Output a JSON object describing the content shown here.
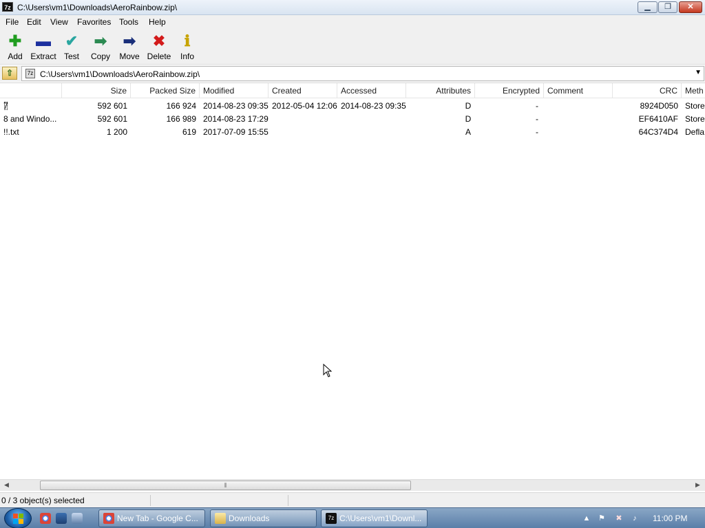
{
  "window": {
    "app_icon": "7z",
    "title": "C:\\Users\\vm1\\Downloads\\AeroRainbow.zip\\",
    "minimize": "▁",
    "maximize": "❐",
    "close": "✕"
  },
  "menu": [
    "File",
    "Edit",
    "View",
    "Favorites",
    "Tools",
    "Help"
  ],
  "toolbar": [
    {
      "label": "Add",
      "icon": "add-icon",
      "glyph": "✚",
      "color": "#1f9c1f"
    },
    {
      "label": "Extract",
      "icon": "extract-icon",
      "glyph": "▬",
      "color": "#1c2f9e"
    },
    {
      "label": "Test",
      "icon": "test-icon",
      "glyph": "✔",
      "color": "#2aa6a0"
    },
    {
      "label": "Copy",
      "icon": "copy-icon",
      "glyph": "➡",
      "color": "#2b8a52"
    },
    {
      "label": "Move",
      "icon": "move-icon",
      "glyph": "➡",
      "color": "#1a2f7a"
    },
    {
      "label": "Delete",
      "icon": "delete-icon",
      "glyph": "✖",
      "color": "#d31b1b"
    },
    {
      "label": "Info",
      "icon": "info-icon",
      "glyph": "ℹ",
      "color": "#c7a300"
    }
  ],
  "address": {
    "path": "C:\\Users\\vm1\\Downloads\\AeroRainbow.zip\\"
  },
  "columns": [
    "",
    "Size",
    "Packed Size",
    "Modified",
    "Created",
    "Accessed",
    "Attributes",
    "Encrypted",
    "Comment",
    "CRC",
    "Meth"
  ],
  "rows": [
    {
      "name": "7",
      "size": "592 601",
      "packed": "166 924",
      "modified": "2014-08-23 09:35",
      "created": "2012-05-04 12:06",
      "accessed": "2014-08-23 09:35",
      "attributes": "D",
      "encrypted": "-",
      "comment": "",
      "crc": "8924D050",
      "method": "Store"
    },
    {
      "name": "8 and Windo...",
      "size": "592 601",
      "packed": "166 989",
      "modified": "2014-08-23 17:29",
      "created": "",
      "accessed": "",
      "attributes": "D",
      "encrypted": "-",
      "comment": "",
      "crc": "EF6410AF",
      "method": "Store"
    },
    {
      "name": "!!.txt",
      "size": "1 200",
      "packed": "619",
      "modified": "2017-07-09 15:55",
      "created": "",
      "accessed": "",
      "attributes": "A",
      "encrypted": "-",
      "comment": "",
      "crc": "64C374D4",
      "method": "Defla"
    }
  ],
  "status": {
    "selection": "0 / 3 object(s) selected"
  },
  "taskbar": {
    "tasks": [
      {
        "label": "New Tab - Google C...",
        "icon": "chrome-icon"
      },
      {
        "label": "Downloads",
        "icon": "folder-icon"
      },
      {
        "label": "C:\\Users\\vm1\\Downl...",
        "icon": "7zip-icon"
      }
    ],
    "clock": "11:00 PM"
  }
}
